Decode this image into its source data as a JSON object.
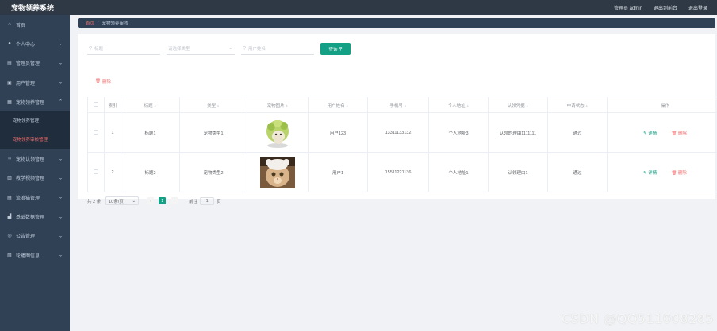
{
  "app": {
    "title": "宠物领养系统"
  },
  "topbar": {
    "role_user": "管理员 admin",
    "back_front": "退出到前台",
    "logout": "退出登录"
  },
  "sidebar": {
    "items": [
      {
        "label": "首页",
        "icon": "home-icon"
      },
      {
        "label": "个人中心",
        "icon": "user-icon"
      },
      {
        "label": "管理员管理",
        "icon": "admin-icon"
      },
      {
        "label": "用户管理",
        "icon": "users-icon"
      },
      {
        "label": "宠物领养管理",
        "icon": "paw-icon"
      },
      {
        "label": "宠物认领管理",
        "icon": "claim-icon"
      },
      {
        "label": "教学视频管理",
        "icon": "video-icon"
      },
      {
        "label": "流浪猫管理",
        "icon": "cat-icon"
      },
      {
        "label": "基础数据管理",
        "icon": "data-icon"
      },
      {
        "label": "公告管理",
        "icon": "notice-icon"
      },
      {
        "label": "轮播图信息",
        "icon": "image-icon"
      }
    ],
    "sub": [
      "宠物领养管理",
      "宠物领养审核管理"
    ]
  },
  "breadcrumb": {
    "home": "首页",
    "sep": "/",
    "current": "宠物领养审核"
  },
  "search": {
    "title_placeholder": "标题",
    "type_placeholder": "请选择类型",
    "user_placeholder": "用户姓名",
    "button": "查询"
  },
  "actions": {
    "delete": "删除"
  },
  "table": {
    "headers": [
      "索引",
      "标题",
      "类型",
      "宠物图片",
      "用户姓名",
      "手机号",
      "个人地址",
      "认领凭据",
      "申请状态",
      "操作"
    ],
    "rows": [
      {
        "index": "1",
        "title": "标题1",
        "type": "宠物类型1",
        "image": "pet-image-1",
        "user": "用户123",
        "phone": "13311133132",
        "address": "个人地址3",
        "reason": "认领的理由1111111",
        "status": "通过"
      },
      {
        "index": "2",
        "title": "标题2",
        "type": "宠物类型2",
        "image": "pet-image-2",
        "user": "用户1",
        "phone": "15511221136",
        "address": "个人地址1",
        "reason": "认领理由1",
        "status": "通过"
      }
    ],
    "op_edit": "详情",
    "op_delete": "删除"
  },
  "pager": {
    "total": "共 2 条",
    "size": "10条/页",
    "current_page": "1",
    "goto_label": "前往",
    "goto_value": "1",
    "page_unit": "页"
  },
  "watermark": "CSDN @QQ511008285",
  "colors": {
    "accent": "#13a085",
    "danger": "#f56c6c",
    "sidebar": "#304156",
    "topbar": "#2e3945"
  }
}
